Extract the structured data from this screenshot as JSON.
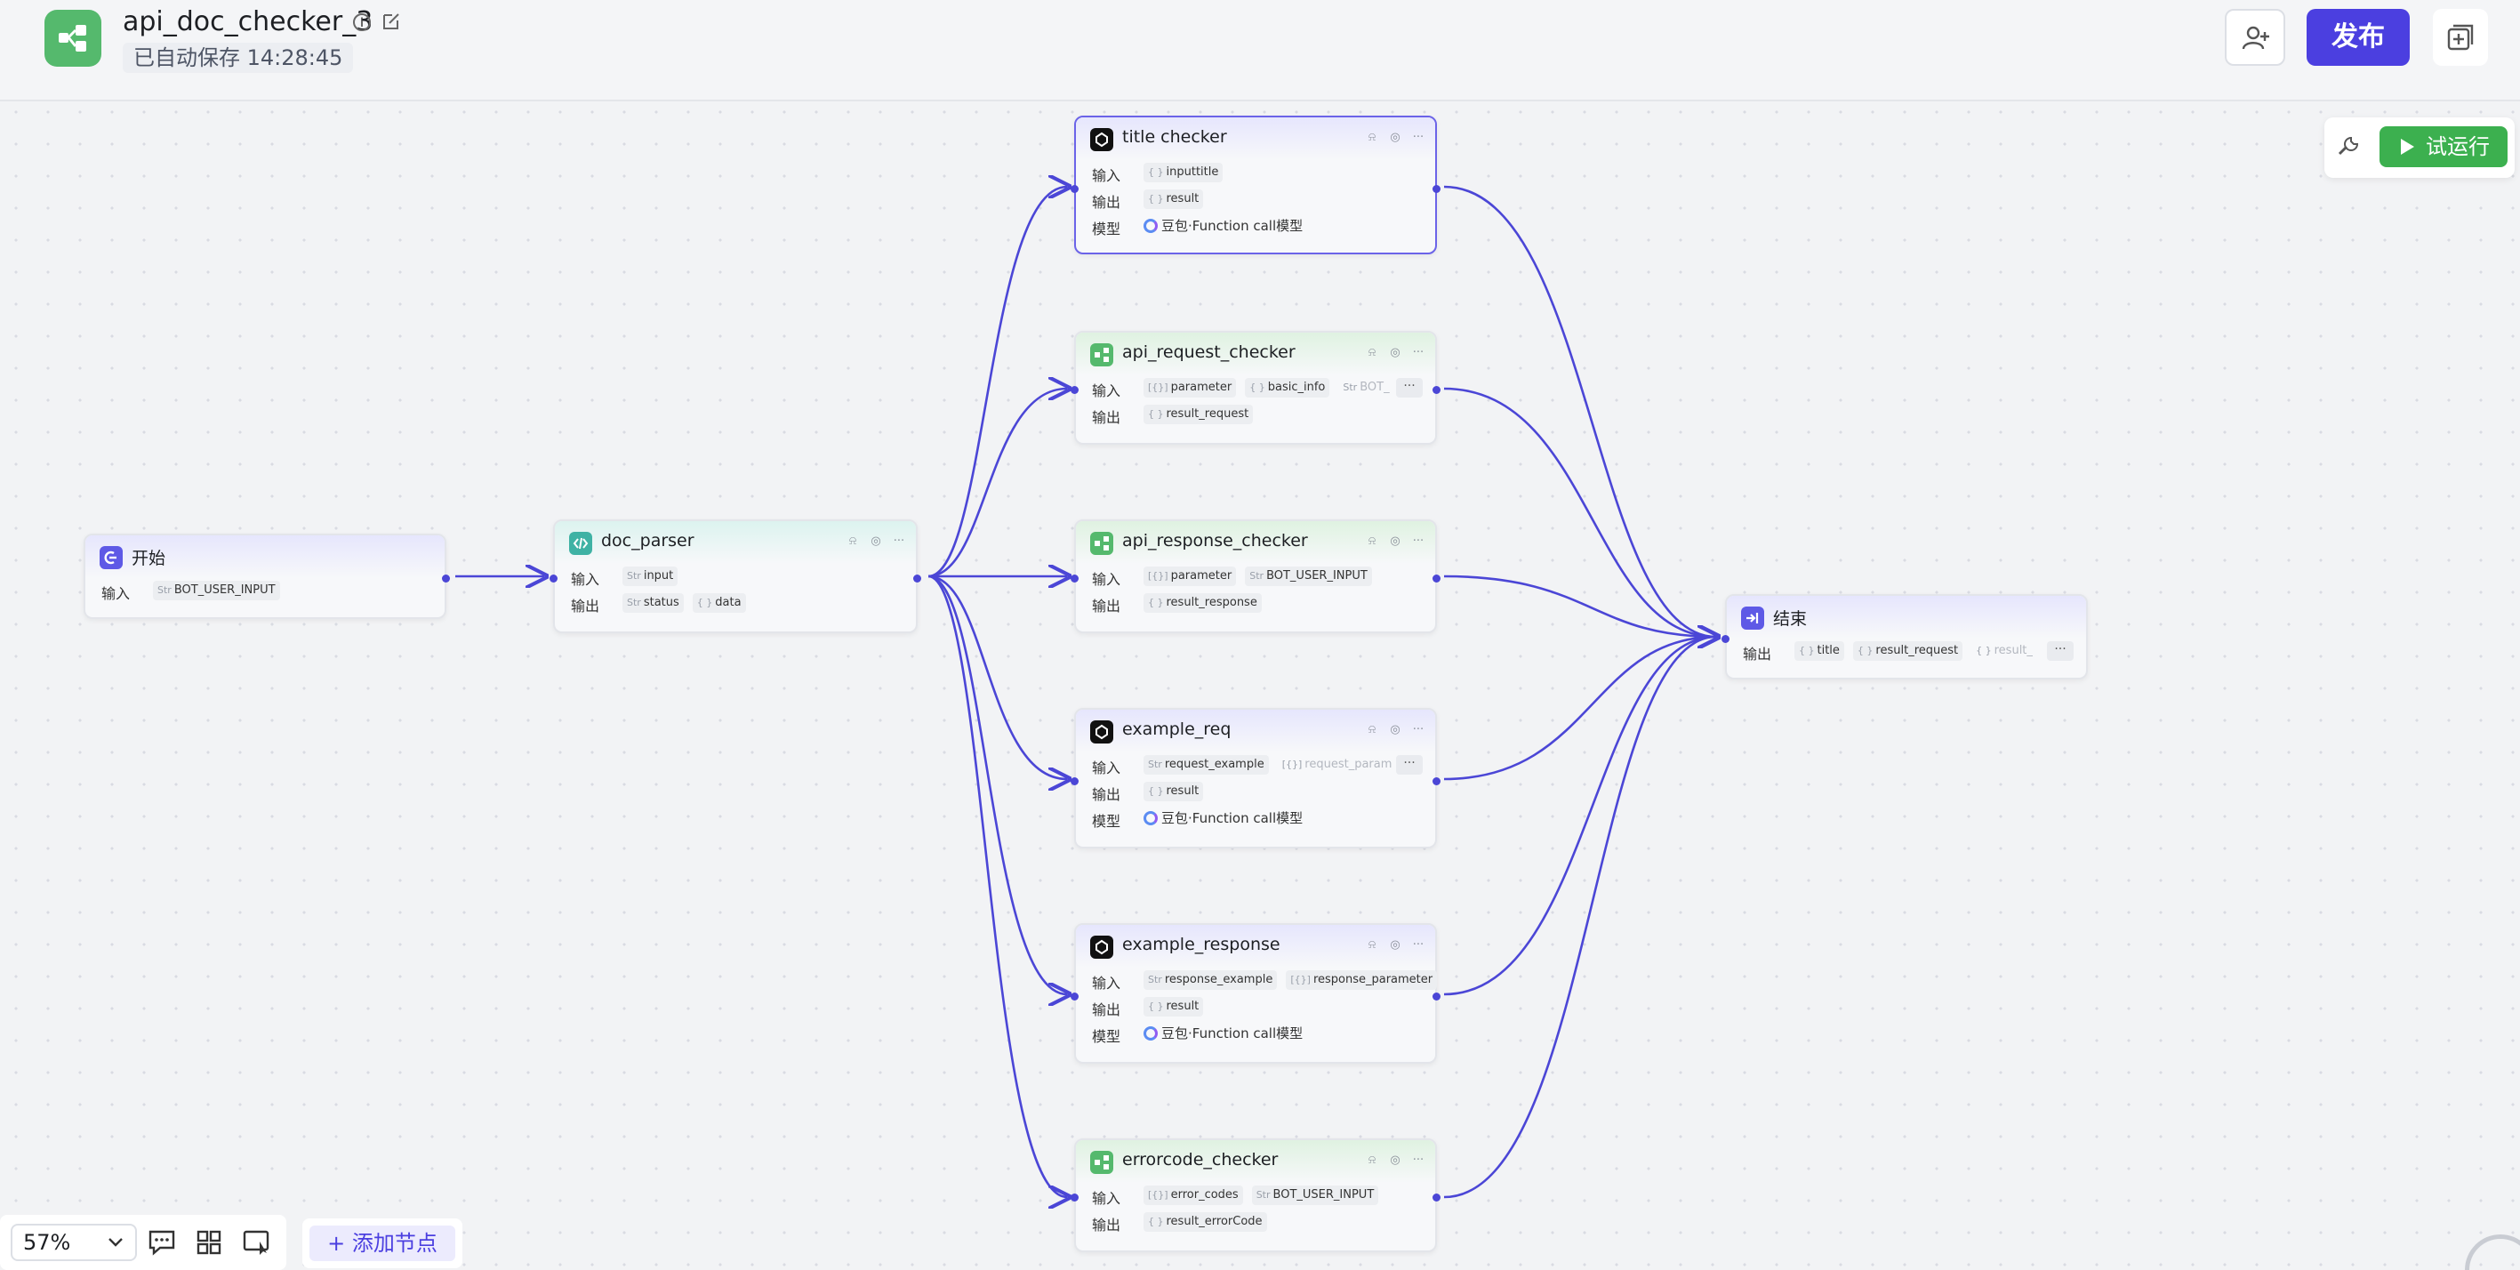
{
  "header": {
    "title": "api_doc_checker_3",
    "autosave": "已自动保存 14:28:45",
    "publish_label": "发布",
    "brand_color": "#4b3fe0"
  },
  "toolbar": {
    "run_label": "试运行"
  },
  "nodes": {
    "start": {
      "title": "开始",
      "in_label": "输入",
      "in_tags": [
        {
          "type": "Str",
          "name": "BOT_USER_INPUT"
        }
      ]
    },
    "doc_parser": {
      "title": "doc_parser",
      "in_label": "输入",
      "out_label": "输出",
      "in_tags": [
        {
          "type": "Str",
          "name": "input"
        }
      ],
      "out_tags": [
        {
          "type": "Str",
          "name": "status"
        },
        {
          "type": "{ }",
          "name": "data"
        }
      ]
    },
    "title_checker": {
      "title": "title checker",
      "in_label": "输入",
      "out_label": "输出",
      "model_label": "模型",
      "in_tags": [
        {
          "type": "{ }",
          "name": "inputtitle"
        }
      ],
      "out_tags": [
        {
          "type": "{ }",
          "name": "result"
        }
      ],
      "model": "豆包·Function call模型"
    },
    "api_request_checker": {
      "title": "api_request_checker",
      "in_label": "输入",
      "out_label": "输出",
      "in_tags": [
        {
          "type": "[{}]",
          "name": "parameter"
        },
        {
          "type": "{ }",
          "name": "basic_info"
        },
        {
          "type": "Str",
          "name": "BOT_"
        }
      ],
      "out_tags": [
        {
          "type": "{ }",
          "name": "result_request"
        }
      ]
    },
    "api_response_checker": {
      "title": "api_response_checker",
      "in_label": "输入",
      "out_label": "输出",
      "in_tags": [
        {
          "type": "[{}]",
          "name": "parameter"
        },
        {
          "type": "Str",
          "name": "BOT_USER_INPUT"
        }
      ],
      "out_tags": [
        {
          "type": "{ }",
          "name": "result_response"
        }
      ]
    },
    "example_req": {
      "title": "example_req",
      "in_label": "输入",
      "out_label": "输出",
      "model_label": "模型",
      "in_tags": [
        {
          "type": "Str",
          "name": "request_example"
        },
        {
          "type": "[{}]",
          "name": "request_param"
        }
      ],
      "out_tags": [
        {
          "type": "{ }",
          "name": "result"
        }
      ],
      "model": "豆包·Function call模型"
    },
    "example_response": {
      "title": "example_response",
      "in_label": "输入",
      "out_label": "输出",
      "model_label": "模型",
      "in_tags": [
        {
          "type": "Str",
          "name": "response_example"
        },
        {
          "type": "[{}]",
          "name": "response_parameter"
        }
      ],
      "out_tags": [
        {
          "type": "{ }",
          "name": "result"
        }
      ],
      "model": "豆包·Function call模型"
    },
    "errorcode_checker": {
      "title": "errorcode_checker",
      "in_label": "输入",
      "out_label": "输出",
      "in_tags": [
        {
          "type": "[{}]",
          "name": "error_codes"
        },
        {
          "type": "Str",
          "name": "BOT_USER_INPUT"
        }
      ],
      "out_tags": [
        {
          "type": "{ }",
          "name": "result_errorCode"
        }
      ]
    },
    "end": {
      "title": "结束",
      "out_label": "输出",
      "out_tags": [
        {
          "type": "{ }",
          "name": "title"
        },
        {
          "type": "{ }",
          "name": "result_request"
        },
        {
          "type": "{ }",
          "name": "result_"
        }
      ]
    }
  },
  "bottom": {
    "zoom": "57%",
    "add_node_label": "+ 添加节点"
  },
  "colors": {
    "edge": "#4b46d6",
    "run_green": "#3cb04f",
    "logo_green": "#55b96d"
  }
}
